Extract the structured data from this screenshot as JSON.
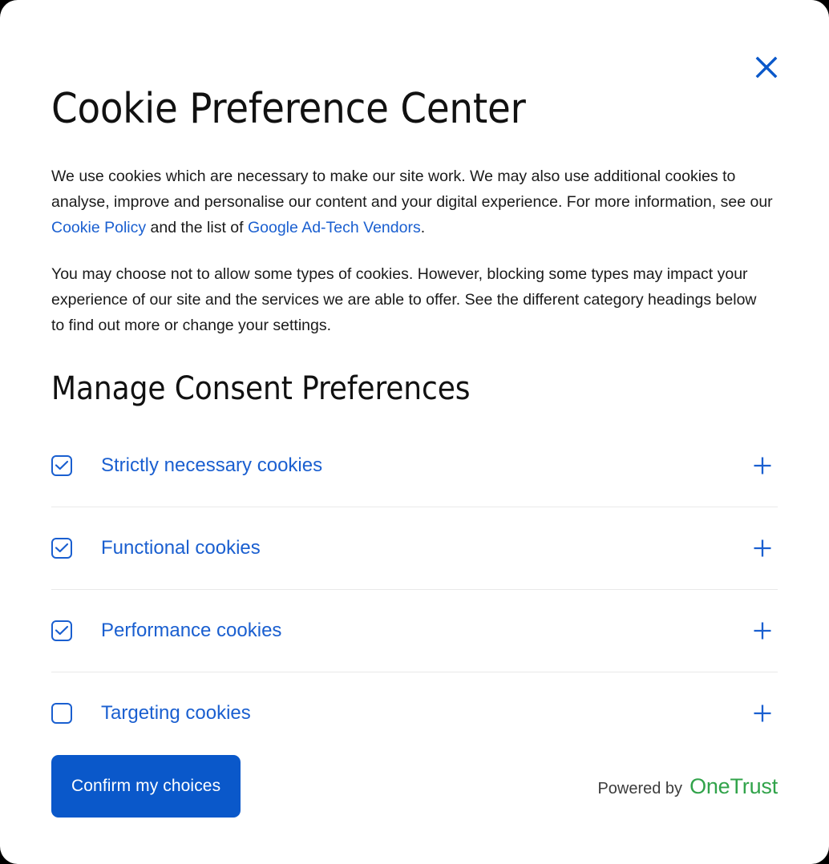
{
  "dialog": {
    "title": "Cookie Preference Center",
    "close_icon": "close-icon",
    "paragraphs": {
      "p1_part1": "We use cookies which are necessary to make our site work. We may also use additional cookies to analyse, improve and personalise our content and your digital experience. For more information, see our ",
      "p1_link1": "Cookie Policy",
      "p1_part2": " and the list of ",
      "p1_link2": "Google Ad-Tech Vendors",
      "p1_part3": ".",
      "p2": "You may choose not to allow some types of cookies. However, blocking some types may impact your experience of our site and the services we are able to offer. See the different category headings below to find out more or change your settings."
    },
    "section_title": "Manage Consent Preferences",
    "categories": [
      {
        "label": "Strictly necessary cookies",
        "checked": true,
        "expand_icon": "plus-icon"
      },
      {
        "label": "Functional cookies",
        "checked": true,
        "expand_icon": "plus-icon"
      },
      {
        "label": "Performance cookies",
        "checked": true,
        "expand_icon": "plus-icon"
      },
      {
        "label": "Targeting cookies",
        "checked": false,
        "expand_icon": "plus-icon"
      }
    ],
    "confirm_label": "Confirm my choices",
    "powered_by_label": "Powered by",
    "powered_by_brand": "OneTrust",
    "colors": {
      "accent_blue": "#1a5fd0",
      "button_blue": "#0a58ca",
      "brand_green": "#31a34a",
      "divider": "#e9e9e9",
      "text": "#1a1a1a"
    }
  }
}
